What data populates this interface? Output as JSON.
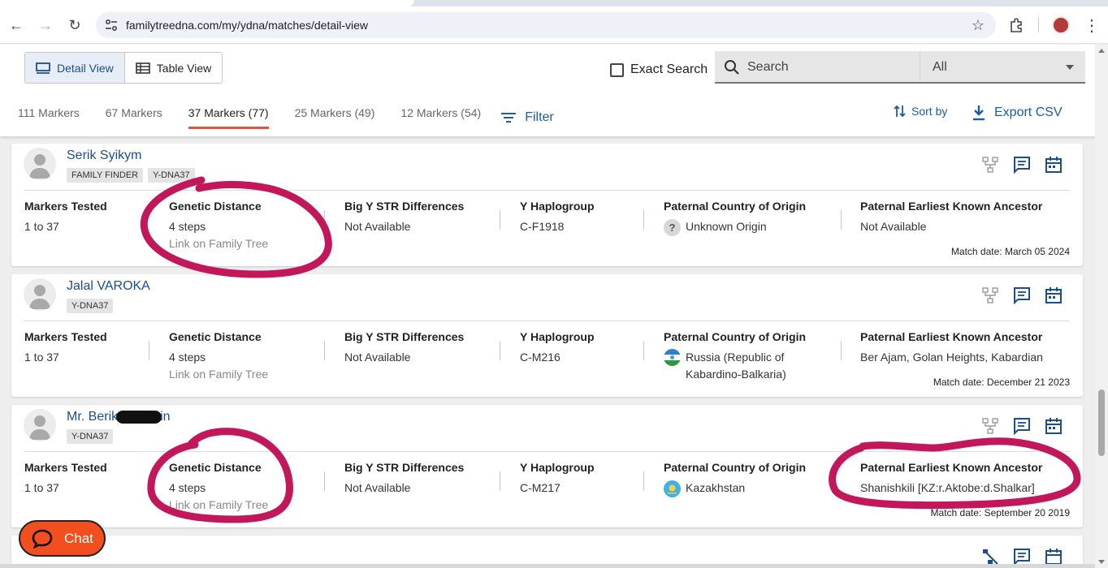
{
  "browser": {
    "url": "familytreedna.com/my/ydna/matches/detail-view"
  },
  "header": {
    "detail_view_label": "Detail View",
    "table_view_label": "Table View",
    "exact_search_label": "Exact Search",
    "search_placeholder": "Search",
    "search_scope": "All",
    "tabs": [
      {
        "label": "111 Markers"
      },
      {
        "label": "67 Markers"
      },
      {
        "label": "37 Markers (77)"
      },
      {
        "label": "25 Markers (49)"
      },
      {
        "label": "12 Markers (54)"
      }
    ],
    "filter_label": "Filter",
    "sort_label": "Sort by",
    "export_label": "Export CSV"
  },
  "columns": {
    "markers_tested": "Markers Tested",
    "genetic_distance": "Genetic Distance",
    "big_y": "Big Y STR Differences",
    "haplogroup": "Y Haplogroup",
    "country": "Paternal Country of Origin",
    "ancestor": "Paternal Earliest Known Ancestor"
  },
  "matches": [
    {
      "name": "Serik Syikym",
      "badges": [
        "FAMILY FINDER",
        "Y-DNA37"
      ],
      "markers": "1 to 37",
      "distance": "4 steps",
      "link": "Link on Family Tree",
      "big_y": "Not Available",
      "haplogroup": "C-F1918",
      "country": "Unknown Origin",
      "country_icon": "question-mark",
      "ancestor": "Not Available",
      "match_date": "Match date: March 05 2024"
    },
    {
      "name": "Jalal VAROKA",
      "badges": [
        "Y-DNA37"
      ],
      "markers": "1 to 37",
      "distance": "4 steps",
      "link": "Link on Family Tree",
      "big_y": "Not Available",
      "haplogroup": "C-M216",
      "country": "Russia (Republic of Kabardino-Balkaria)",
      "country_icon": "kabardino-balkaria-flag",
      "ancestor": "Ber Ajam, Golan Heights, Kabardian",
      "match_date": "Match date: December 21 2023"
    },
    {
      "name": "Mr. Berik",
      "name_suffix": "in",
      "badges": [
        "Y-DNA37"
      ],
      "markers": "1 to 37",
      "distance": "4 steps",
      "link": "Link on Family Tree",
      "big_y": "Not Available",
      "haplogroup": "C-M217",
      "country": "Kazakhstan",
      "country_icon": "kazakhstan-flag",
      "ancestor": "Shanishkili [KZ:r.Aktobe:d.Shalkar]",
      "match_date": "Match date: September 20 2019"
    }
  ],
  "chat_label": "Chat",
  "colors": {
    "link_blue": "#1a5ca6",
    "accent_orange": "#e1553a",
    "annotation": "#c2185b",
    "chat_bg": "#f24e1e"
  }
}
